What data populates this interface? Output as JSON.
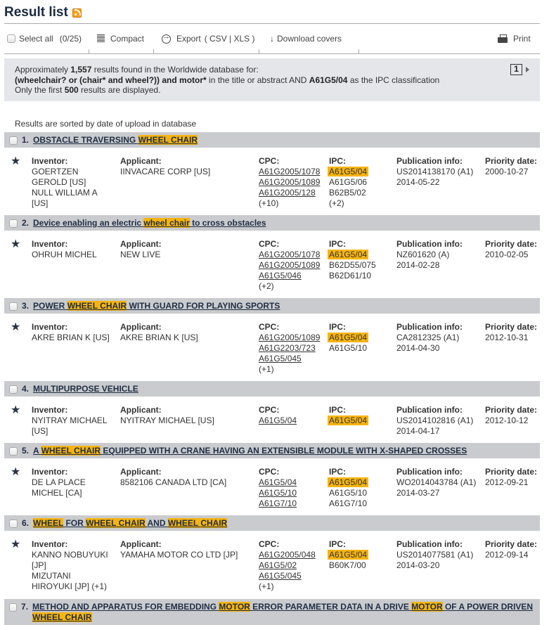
{
  "header": {
    "title": "Result list",
    "rss_icon": "rss-feed-icon"
  },
  "toolbar": {
    "select_all": "Select all",
    "selected_count": "(0/25)",
    "compact": "Compact",
    "export": "Export",
    "export_formats": "( CSV | XLS )",
    "download_covers": "Download covers",
    "print": "Print"
  },
  "info": {
    "line1_pre": "Approximately ",
    "count": "1,557",
    "line1_post": " results found in the Worldwide database for:",
    "query": "(wheelchair? or (chair* and wheel?)) and motor*",
    "line2_mid": " in the title or abstract AND ",
    "ipc": "A61G5/04",
    "line2_post": " as the IPC classification",
    "line3_pre": "Only the first ",
    "limit": "500",
    "line3_post": " results are displayed.",
    "page": "1"
  },
  "sorted_text": "Results are sorted by date of upload in database",
  "labels": {
    "inventor": "Inventor:",
    "applicant": "Applicant:",
    "cpc": "CPC:",
    "ipc": "IPC:",
    "publication": "Publication info:",
    "priority": "Priority date:"
  },
  "results": [
    {
      "num": "1.",
      "title_parts": [
        {
          "t": "OBSTACLE TRAVERSING ",
          "hl": false
        },
        {
          "t": "WHEEL",
          "hl": true
        },
        {
          "t": " ",
          "hl": true
        },
        {
          "t": "CHAIR",
          "hl": true
        }
      ],
      "inventor": [
        "GOERTZEN",
        "GEROLD  [US]",
        "NULL WILLIAM A",
        "[US]"
      ],
      "applicant": [
        "IINVACARE CORP  [US]"
      ],
      "cpc": [
        "A61G2005/1078",
        "A61G2005/1089",
        "A61G2005/128"
      ],
      "cpc_more": "(+10)",
      "ipc_main": "A61G5/04",
      "ipc": [
        "A61G5/06",
        "B62B5/02"
      ],
      "ipc_more": "(+2)",
      "publication": [
        "US2014138170 (A1)",
        "2014-05-22"
      ],
      "priority": "2000-10-27"
    },
    {
      "num": "2.",
      "title_parts": [
        {
          "t": "Device enabling an electric ",
          "hl": false
        },
        {
          "t": "wheel",
          "hl": true
        },
        {
          "t": " ",
          "hl": true
        },
        {
          "t": "chair",
          "hl": true
        },
        {
          "t": " to cross obstacles",
          "hl": false
        }
      ],
      "inventor": [
        "OHRUH MICHEL"
      ],
      "applicant": [
        "NEW LIVE"
      ],
      "cpc": [
        "A61G2005/1078",
        "A61G2005/1089",
        "A61G5/046"
      ],
      "cpc_more": "(+2)",
      "ipc_main": "A61G5/04",
      "ipc": [
        "B62D55/075",
        "B62D61/10"
      ],
      "ipc_more": "",
      "publication": [
        "NZ601620 (A)",
        "2014-02-28"
      ],
      "priority": "2010-02-05"
    },
    {
      "num": "3.",
      "title_parts": [
        {
          "t": "POWER ",
          "hl": false
        },
        {
          "t": "WHEEL",
          "hl": true
        },
        {
          "t": " ",
          "hl": true
        },
        {
          "t": "CHAIR",
          "hl": true
        },
        {
          "t": " WITH GUARD FOR PLAYING SPORTS",
          "hl": false
        }
      ],
      "inventor": [
        "AKRE BRIAN K  [US]"
      ],
      "applicant": [
        "AKRE BRIAN K  [US]"
      ],
      "cpc": [
        "A61G2005/1089",
        "A61G2203/723",
        "A61G5/045"
      ],
      "cpc_more": "(+1)",
      "ipc_main": "A61G5/04",
      "ipc": [
        "A61G5/10"
      ],
      "ipc_more": "",
      "publication": [
        "CA2812325 (A1)",
        "2014-04-30"
      ],
      "priority": "2012-10-31"
    },
    {
      "num": "4.",
      "title_parts": [
        {
          "t": "MULTIPURPOSE VEHICLE",
          "hl": false
        }
      ],
      "inventor": [
        "NYITRAY MICHAEL",
        "[US]"
      ],
      "applicant": [
        "NYITRAY MICHAEL  [US]"
      ],
      "cpc": [
        "A61G5/04"
      ],
      "cpc_more": "",
      "ipc_main": "A61G5/04",
      "ipc": [],
      "ipc_more": "",
      "publication": [
        "US2014102816 (A1)",
        "2014-04-17"
      ],
      "priority": "2012-10-12"
    },
    {
      "num": "5.",
      "title_parts": [
        {
          "t": "A ",
          "hl": false
        },
        {
          "t": "WHEEL",
          "hl": true
        },
        {
          "t": " ",
          "hl": true
        },
        {
          "t": "CHAIR",
          "hl": true
        },
        {
          "t": " EQUIPPED WITH A CRANE HAVING AN EXTENSIBLE MODULE WITH X-SHAPED CROSSES",
          "hl": false
        }
      ],
      "inventor": [
        "DE LA PLACE",
        "MICHEL  [CA]"
      ],
      "applicant": [
        "8582106 CANADA LTD  [CA]"
      ],
      "cpc": [
        "A61G5/04",
        "A61G5/10",
        "A61G7/10"
      ],
      "cpc_more": "",
      "ipc_main": "A61G5/04",
      "ipc": [
        "A61G5/10",
        "A61G7/10"
      ],
      "ipc_more": "",
      "publication": [
        "WO2014043784 (A1)",
        "2014-03-27"
      ],
      "priority": "2012-09-21"
    },
    {
      "num": "6.",
      "title_parts": [
        {
          "t": "WHEEL",
          "hl": true
        },
        {
          "t": " FOR ",
          "hl": false
        },
        {
          "t": "WHEEL",
          "hl": true
        },
        {
          "t": " ",
          "hl": true
        },
        {
          "t": "CHAIR",
          "hl": true
        },
        {
          "t": " AND ",
          "hl": false
        },
        {
          "t": "WHEEL",
          "hl": true
        },
        {
          "t": " ",
          "hl": true
        },
        {
          "t": "CHAIR",
          "hl": true
        }
      ],
      "inventor": [
        "KANNO NOBUYUKI",
        "[JP]",
        "MIZUTANI",
        "HIROYUKI  [JP] (+1)"
      ],
      "applicant": [
        "YAMAHA MOTOR CO LTD  [JP]"
      ],
      "cpc": [
        "A61G2005/048",
        "A61G5/02",
        "A61G5/045"
      ],
      "cpc_more": "(+1)",
      "ipc_main": "A61G5/04",
      "ipc": [
        "B60K7/00"
      ],
      "ipc_more": "",
      "publication": [
        "US2014077581 (A1)",
        "2014-03-20"
      ],
      "priority": "2012-09-14"
    },
    {
      "num": "7.",
      "title_parts": [
        {
          "t": "METHOD AND APPARATUS FOR EMBEDDING ",
          "hl": false
        },
        {
          "t": "MOTOR",
          "hl": true
        },
        {
          "t": " ERROR PARAMETER DATA IN A DRIVE ",
          "hl": false
        },
        {
          "t": "MOTOR",
          "hl": true
        },
        {
          "t": " OF A POWER DRIVEN ",
          "hl": false
        },
        {
          "t": "WHEEL",
          "hl": true
        },
        {
          "t": " ",
          "hl": true
        },
        {
          "t": "CHAIR",
          "hl": true
        }
      ]
    }
  ]
}
